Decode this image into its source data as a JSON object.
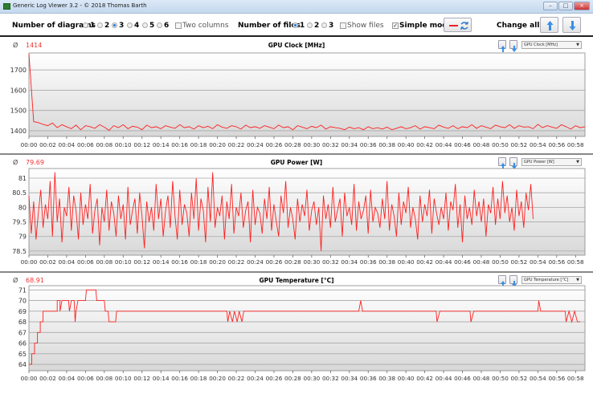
{
  "window": {
    "title": "Generic Log Viewer 3.2 - © 2018 Thomas Barth",
    "min": "–",
    "max": "□",
    "close": "×"
  },
  "toolbar": {
    "diagrams_label": "Number of diagrams",
    "diagram_options": [
      "1",
      "2",
      "3",
      "4",
      "5",
      "6"
    ],
    "diagrams_selected": "3",
    "two_columns_label": "Two columns",
    "files_label": "Number of files",
    "file_options": [
      "1",
      "2",
      "3"
    ],
    "files_selected": "1",
    "show_files_label": "Show files",
    "simple_mode_label": "Simple mode",
    "simple_mode_checked": true,
    "change_all_label": "Change all"
  },
  "colors": {
    "series": "#ff2020",
    "accent": "#2a7bd6"
  },
  "chart_data": [
    {
      "type": "line",
      "title": "GPU Clock [MHz]",
      "avg_symbol": "Ø",
      "avg": "1414",
      "select": "GPU Clock [MHz]",
      "yticks": [
        1400,
        1500,
        1600,
        1700
      ],
      "ylim": [
        1372,
        1784
      ],
      "xlim": [
        0,
        59
      ],
      "xticks": [
        "00:00",
        "00:02",
        "00:04",
        "00:06",
        "00:08",
        "00:10",
        "00:12",
        "00:14",
        "00:16",
        "00:18",
        "00:20",
        "00:22",
        "00:24",
        "00:26",
        "00:28",
        "00:30",
        "00:32",
        "00:34",
        "00:36",
        "00:38",
        "00:40",
        "00:42",
        "00:44",
        "00:46",
        "00:48",
        "00:50",
        "00:52",
        "00:54",
        "00:56",
        "00:58"
      ],
      "xstep_min": 0.5,
      "values": [
        1780,
        1445,
        1440,
        1432,
        1425,
        1438,
        1415,
        1430,
        1420,
        1410,
        1428,
        1405,
        1425,
        1420,
        1412,
        1430,
        1418,
        1402,
        1425,
        1415,
        1430,
        1410,
        1422,
        1418,
        1405,
        1428,
        1415,
        1420,
        1410,
        1425,
        1418,
        1412,
        1430,
        1415,
        1420,
        1408,
        1425,
        1415,
        1422,
        1410,
        1430,
        1418,
        1412,
        1425,
        1420,
        1408,
        1428,
        1415,
        1420,
        1412,
        1425,
        1418,
        1410,
        1428,
        1415,
        1420,
        1405,
        1425,
        1418,
        1410,
        1422,
        1415,
        1428,
        1408,
        1420,
        1415,
        1412,
        1405,
        1418,
        1410,
        1415,
        1405,
        1420,
        1410,
        1415,
        1408,
        1418,
        1405,
        1412,
        1420,
        1410,
        1415,
        1425,
        1408,
        1420,
        1415,
        1410,
        1428,
        1418,
        1412,
        1425,
        1410,
        1420,
        1415,
        1430,
        1412,
        1425,
        1418,
        1410,
        1428,
        1420,
        1415,
        1430,
        1412,
        1425,
        1418,
        1420,
        1410,
        1432,
        1415,
        1425,
        1418,
        1412,
        1430,
        1420,
        1408,
        1425,
        1415,
        1420
      ]
    },
    {
      "type": "line",
      "title": "GPU Power [W]",
      "avg_symbol": "Ø",
      "avg": "79.69",
      "select": "GPU Power [W]",
      "yticks": [
        78.5,
        79,
        79.5,
        80,
        80.5,
        81
      ],
      "ylim": [
        78.36,
        81.33
      ],
      "xlim": [
        0,
        59
      ],
      "xticks": [
        "00:00",
        "00:02",
        "00:04",
        "00:06",
        "00:08",
        "00:10",
        "00:12",
        "00:14",
        "00:16",
        "00:18",
        "00:20",
        "00:22",
        "00:24",
        "00:26",
        "00:28",
        "00:30",
        "00:32",
        "00:34",
        "00:36",
        "00:38",
        "00:40",
        "00:42",
        "00:44",
        "00:46",
        "00:48",
        "00:50",
        "00:52",
        "00:54",
        "00:56",
        "00:58"
      ],
      "xstep_min": 0.25,
      "values": [
        80.4,
        79.1,
        80.2,
        78.9,
        79.8,
        80.6,
        79.3,
        80.1,
        79.6,
        80.9,
        79.0,
        81.2,
        79.5,
        80.3,
        78.8,
        80.0,
        79.7,
        80.7,
        79.2,
        80.4,
        79.9,
        78.9,
        80.5,
        79.4,
        80.1,
        79.6,
        80.8,
        79.1,
        79.9,
        80.3,
        78.7,
        80.0,
        79.5,
        80.6,
        79.2,
        80.2,
        79.8,
        79.0,
        80.4,
        79.6,
        80.1,
        78.9,
        80.7,
        79.4,
        79.9,
        80.3,
        79.1,
        80.5,
        79.7,
        78.6,
        80.2,
        79.5,
        80.0,
        79.2,
        80.8,
        79.6,
        80.3,
        79.0,
        79.9,
        80.4,
        79.3,
        80.9,
        79.7,
        78.9,
        80.6,
        79.4,
        80.1,
        79.8,
        79.0,
        80.5,
        79.6,
        81.0,
        79.2,
        80.3,
        79.9,
        78.8,
        80.7,
        79.5,
        81.2,
        79.3,
        80.0,
        79.7,
        80.4,
        78.9,
        80.2,
        79.6,
        80.8,
        79.1,
        80.0,
        79.7,
        80.5,
        79.3,
        79.9,
        80.2,
        78.8,
        80.6,
        79.4,
        80.0,
        79.8,
        79.1,
        80.3,
        79.6,
        80.7,
        79.2,
        80.1,
        79.5,
        79.0,
        80.4,
        79.8,
        80.9,
        79.3,
        80.0,
        79.6,
        78.9,
        80.3,
        79.5,
        80.1,
        79.7,
        80.6,
        79.2,
        79.9,
        80.2,
        79.4,
        80.0,
        78.5,
        80.4,
        79.6,
        80.1,
        79.3,
        80.7,
        79.5,
        79.9,
        80.3,
        79.0,
        80.5,
        79.7,
        80.0,
        79.4,
        80.8,
        79.2,
        80.2,
        79.6,
        79.9,
        80.4,
        79.1,
        80.6,
        79.5,
        80.0,
        79.8,
        79.3,
        80.3,
        79.6,
        80.9,
        79.2,
        80.1,
        79.7,
        79.0,
        80.5,
        79.4,
        80.2,
        79.8,
        80.7,
        79.3,
        80.0,
        79.6,
        78.9,
        80.4,
        79.5,
        80.1,
        79.7,
        80.6,
        79.1,
        80.3,
        79.8,
        79.4,
        80.0,
        79.6,
        80.5,
        79.2,
        80.2,
        79.9,
        80.8,
        79.3,
        80.1,
        78.8,
        80.4,
        79.6,
        80.0,
        79.4,
        80.6,
        79.7,
        80.2,
        79.5,
        80.3,
        79.0,
        80.1,
        79.8,
        80.7,
        79.4,
        80.3,
        79.6,
        80.9,
        79.8,
        80.4,
        79.5,
        80.0,
        79.2,
        80.6,
        79.7,
        80.2,
        79.3,
        80.5,
        79.9,
        80.8,
        79.6
      ]
    },
    {
      "type": "line",
      "title": "GPU Temperature [°C]",
      "avg_symbol": "Ø",
      "avg": "68.91",
      "select": "GPU Temperature [°C]",
      "yticks": [
        64,
        65,
        66,
        67,
        68,
        69,
        70,
        71
      ],
      "ylim": [
        63.4,
        71.4
      ],
      "xlim": [
        0,
        59
      ],
      "xticks": [
        "00:00",
        "00:02",
        "00:04",
        "00:06",
        "00:08",
        "00:10",
        "00:12",
        "00:14",
        "00:16",
        "00:18",
        "00:20",
        "00:22",
        "00:24",
        "00:26",
        "00:28",
        "00:30",
        "00:32",
        "00:34",
        "00:36",
        "00:38",
        "00:40",
        "00:42",
        "00:44",
        "00:46",
        "00:48",
        "00:50",
        "00:52",
        "00:54",
        "00:56",
        "00:58"
      ],
      "points": [
        [
          0,
          64
        ],
        [
          0.3,
          64
        ],
        [
          0.3,
          65
        ],
        [
          0.6,
          65
        ],
        [
          0.6,
          66
        ],
        [
          0.9,
          66
        ],
        [
          0.9,
          67
        ],
        [
          1.2,
          67
        ],
        [
          1.2,
          68
        ],
        [
          1.5,
          68
        ],
        [
          1.5,
          69
        ],
        [
          3.0,
          69
        ],
        [
          3.0,
          70
        ],
        [
          3.3,
          70
        ],
        [
          3.3,
          69
        ],
        [
          3.5,
          70
        ],
        [
          4.2,
          70
        ],
        [
          4.3,
          69
        ],
        [
          4.5,
          70
        ],
        [
          4.8,
          70
        ],
        [
          4.9,
          68
        ],
        [
          5.0,
          69
        ],
        [
          5.2,
          70
        ],
        [
          6.0,
          70
        ],
        [
          6.1,
          71
        ],
        [
          7.1,
          71
        ],
        [
          7.2,
          70
        ],
        [
          8.0,
          70
        ],
        [
          8.1,
          69
        ],
        [
          8.4,
          69
        ],
        [
          8.5,
          68
        ],
        [
          9.2,
          68
        ],
        [
          9.3,
          69
        ],
        [
          21.0,
          69
        ],
        [
          21.1,
          68
        ],
        [
          21.3,
          69
        ],
        [
          21.6,
          68
        ],
        [
          21.8,
          69
        ],
        [
          22.1,
          68
        ],
        [
          22.3,
          69
        ],
        [
          22.6,
          68
        ],
        [
          22.8,
          69
        ],
        [
          35.0,
          69
        ],
        [
          35.2,
          70
        ],
        [
          35.4,
          69
        ],
        [
          43.2,
          69
        ],
        [
          43.3,
          68
        ],
        [
          43.6,
          69
        ],
        [
          46.8,
          69
        ],
        [
          46.9,
          68
        ],
        [
          47.2,
          69
        ],
        [
          54.0,
          69
        ],
        [
          54.1,
          70
        ],
        [
          54.3,
          69
        ],
        [
          56.9,
          69
        ],
        [
          57.0,
          68
        ],
        [
          57.3,
          69
        ],
        [
          57.6,
          68
        ],
        [
          57.9,
          69
        ],
        [
          58.2,
          68
        ],
        [
          58.5,
          68
        ]
      ]
    }
  ]
}
